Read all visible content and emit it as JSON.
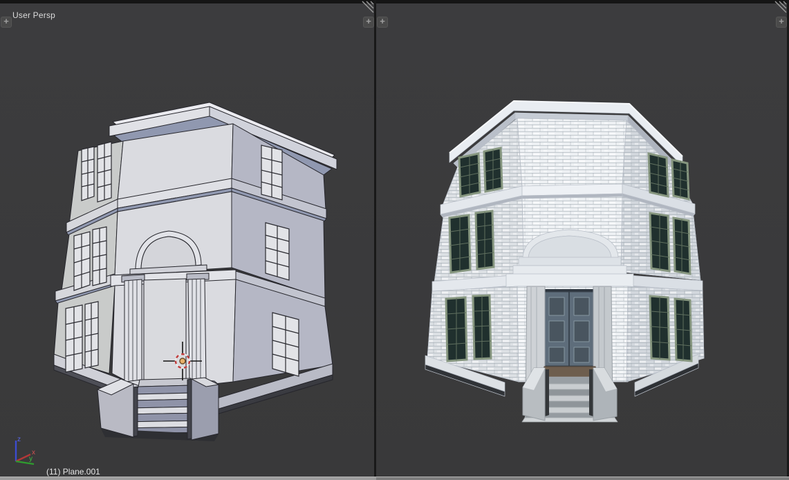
{
  "left_viewport": {
    "view_label": "User Persp",
    "active_object_label": "(11) Plane.001",
    "scene": "untextured three-story building model, solid shading with wireframe edges",
    "axis_gizmo": {
      "x_label": "x",
      "y_label": "y",
      "z_label": "z",
      "x_color": "#c64b4b",
      "y_color": "#46a846",
      "z_color": "#4a5ae0"
    },
    "cursor": {
      "name": "3d-cursor",
      "center_color": "#e8b06a",
      "ring_color": "#c23b3b"
    }
  },
  "right_viewport": {
    "scene": "textured three-story building model, white brick walls, green-framed windows, steel door"
  },
  "icons": {
    "expand_glyph": "+",
    "expand_name": "expand-region-icon",
    "resize_grip_name": "region-resize-grip"
  },
  "colors": {
    "viewport_background": "#3a3a3b",
    "top_edge": "#151515",
    "bottom_bar_left": "#9c9c9c",
    "bottom_bar_right": "#7c7c7c",
    "model_face_light": "#dadbe0",
    "model_face_shaded": "#b5b7c5",
    "cornice_shadow": "#9098b0",
    "brick": "#e9ecef",
    "window_frame_green": "#86967f",
    "window_glass": "#202e2c",
    "door_steel": "#5e6d7b",
    "landing_wood": "#6e5e4e"
  }
}
